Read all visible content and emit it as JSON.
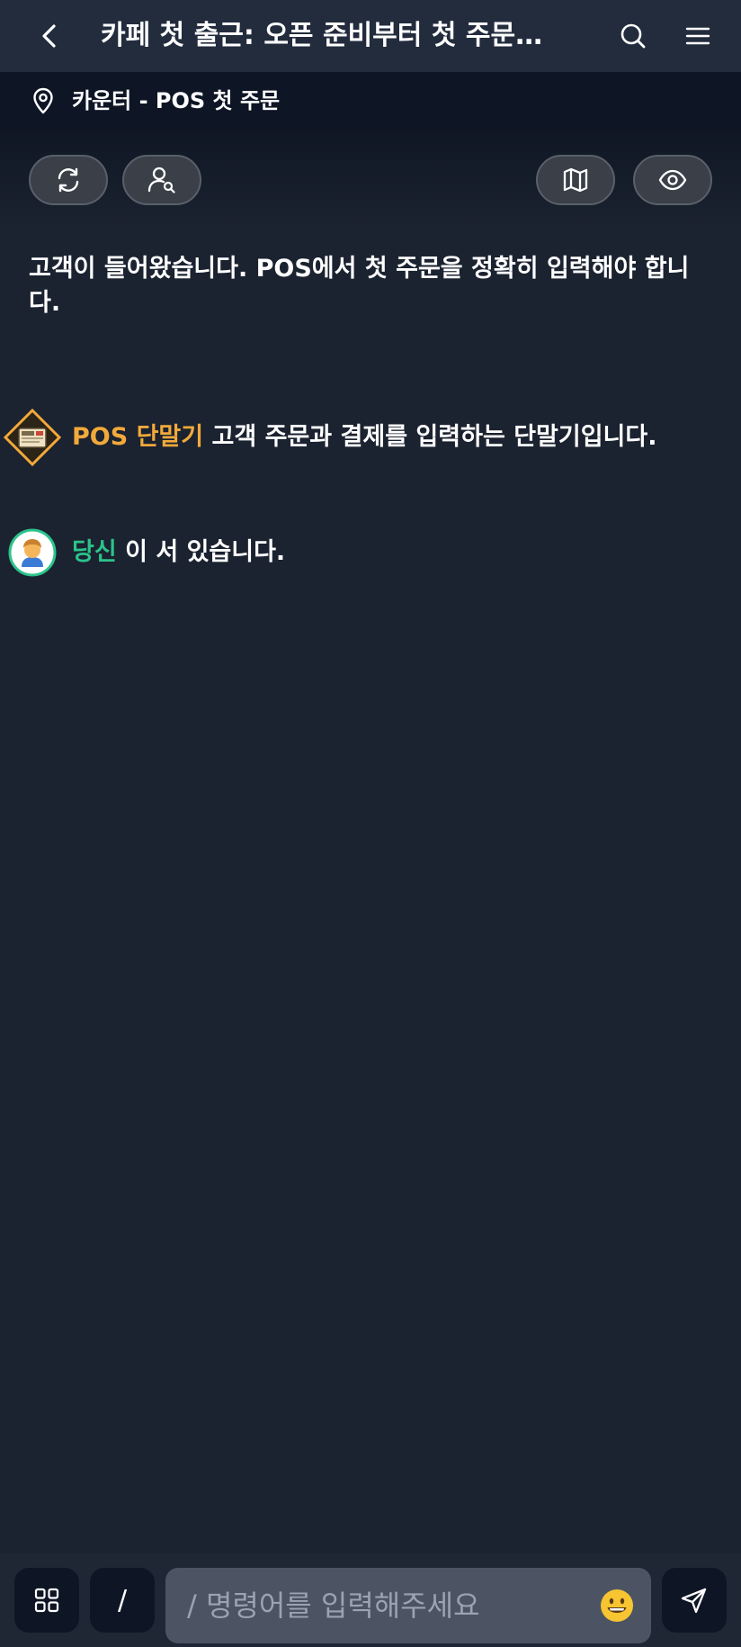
{
  "header": {
    "title": "카페 첫 출근: 오픈 준비부터 첫 주문…",
    "back_icon": "chevron-left-icon",
    "search_icon": "search-icon",
    "menu_icon": "hamburger-menu-icon"
  },
  "location": {
    "icon": "map-pin-icon",
    "text": "카운터 - POS 첫 주문"
  },
  "toolbar": {
    "left": [
      "refresh-icon",
      "person-search-icon"
    ],
    "right": [
      "map-icon",
      "eye-icon"
    ]
  },
  "narration": "고객이 들어왔습니다. POS에서 첫 주문을 정확히 입력해야 합니다.",
  "entities": [
    {
      "icon": "pos-terminal-icon",
      "name": "POS 단말기",
      "description": "고객 주문과 결제를 입력하는 단말기입니다.",
      "color": "#f2a93b"
    },
    {
      "icon": "person-avatar-icon",
      "name": "당신",
      "description": "이 서 있습니다.",
      "color": "#2bc48a"
    }
  ],
  "bottom_bar": {
    "grid_icon": "grid-icon",
    "slash_label": "/",
    "input_placeholder": "/ 명령어를 입력해주세요",
    "input_value": "",
    "emoji_icon": "smiley-emoji-icon",
    "send_icon": "send-icon"
  },
  "colors": {
    "background": "#1b2230",
    "header": "#222c3d",
    "location_bar": "#0e1525",
    "accent_orange": "#f2a93b",
    "accent_green": "#2bc48a"
  }
}
